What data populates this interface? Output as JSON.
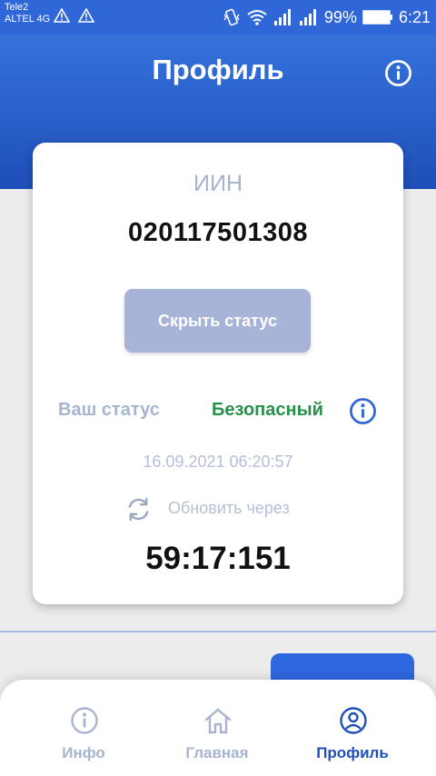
{
  "status_bar": {
    "carrier1": "Tele2",
    "carrier2": "ALTEL 4G",
    "battery": "99%",
    "time": "6:21"
  },
  "header": {
    "title": "Профиль",
    "info_icon": "info-circle-icon"
  },
  "card": {
    "iin_label": "ИИН",
    "iin_value": "020117501308",
    "hide_button": "Скрыть статус",
    "status_label": "Ваш статус",
    "status_value": "Безопасный",
    "timestamp": "16.09.2021 06:20:57",
    "refresh_label": "Обновить через",
    "countdown": "59:17:151"
  },
  "nav": {
    "items": [
      {
        "label": "Инфо",
        "icon": "info-circle-icon",
        "active": false
      },
      {
        "label": "Главная",
        "icon": "home-icon",
        "active": false
      },
      {
        "label": "Профиль",
        "icon": "user-circle-icon",
        "active": true
      }
    ]
  },
  "colors": {
    "primary": "#2f67d9",
    "safe_green": "#26914a",
    "muted": "#a7b4cf",
    "button_disabled": "#a7b4d8"
  }
}
